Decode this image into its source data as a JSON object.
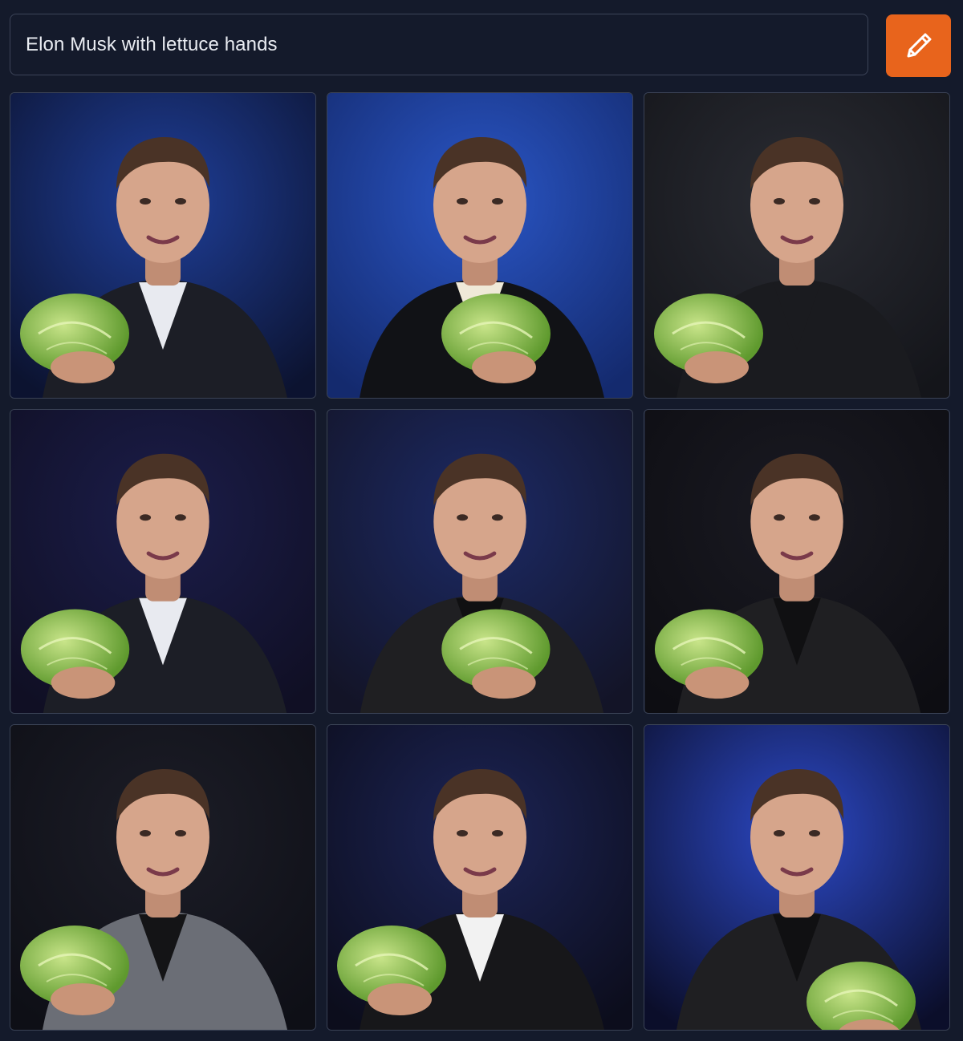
{
  "prompt": {
    "value": "Elon Musk with lettuce hands"
  },
  "edit_button": {
    "icon": "pencil-icon",
    "color": "#e8641c"
  },
  "results": [
    {
      "id": 1,
      "bg": "#0c1330",
      "accent": "#1f3f9a",
      "outfit": "suit-white-shirt",
      "lettuce": "left"
    },
    {
      "id": 2,
      "bg": "#142a6e",
      "accent": "#2a56c6",
      "outfit": "tuxedo",
      "lettuce": "center"
    },
    {
      "id": 3,
      "bg": "#14151a",
      "accent": "#2a2c33",
      "outfit": "black-tshirt",
      "lettuce": "left"
    },
    {
      "id": 4,
      "bg": "#100f24",
      "accent": "#1b1d4a",
      "outfit": "suit-white-shirt",
      "lettuce": "left"
    },
    {
      "id": 5,
      "bg": "#131427",
      "accent": "#1c2a66",
      "outfit": "black-jacket",
      "lettuce": "center"
    },
    {
      "id": 6,
      "bg": "#0d0d12",
      "accent": "#1a1a22",
      "outfit": "black-jacket",
      "lettuce": "left"
    },
    {
      "id": 7,
      "bg": "#0e0f16",
      "accent": "#1c1d27",
      "outfit": "grey-blazer",
      "lettuce": "left"
    },
    {
      "id": 8,
      "bg": "#0c0d1c",
      "accent": "#1c2456",
      "outfit": "black-sweater",
      "lettuce": "left"
    },
    {
      "id": 9,
      "bg": "#0b0e2a",
      "accent": "#2c49c7",
      "outfit": "black-jacket",
      "lettuce": "bottom"
    }
  ]
}
